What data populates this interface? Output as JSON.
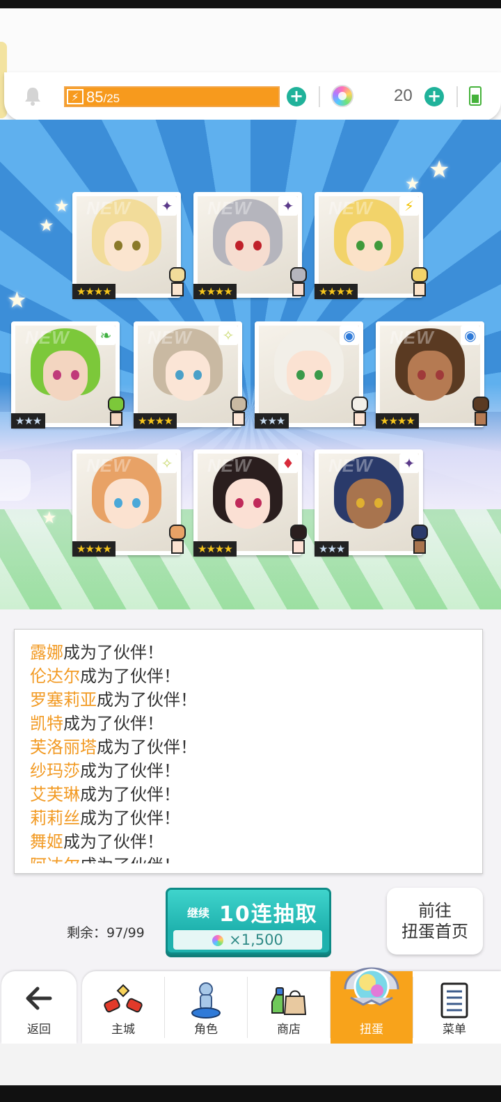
{
  "resources": {
    "stamina_current": "85",
    "stamina_max": "/25",
    "gem_count": "20"
  },
  "cards": [
    {
      "stars": "★★★★",
      "element": "✦",
      "element_color": "#5b3a8a",
      "hair": "#f2dc9a",
      "skin": "#fbe5cf",
      "eye": "#8a7a2a",
      "new": "NEW"
    },
    {
      "stars": "★★★★",
      "element": "✦",
      "element_color": "#5b3a8a",
      "hair": "#b5b5bd",
      "skin": "#f6ddd0",
      "eye": "#c0202a",
      "new": "NEW"
    },
    {
      "stars": "★★★★",
      "element": "⚡",
      "element_color": "#f2c200",
      "hair": "#f2d36a",
      "skin": "#fbe2c8",
      "eye": "#3f9a3a",
      "new": "NEW"
    },
    {
      "stars": "★★★",
      "element": "❧",
      "element_color": "#3fb040",
      "hair": "#7cc83a",
      "skin": "#f3d5c0",
      "eye": "#c03a7a",
      "new": "NEW"
    },
    {
      "stars": "★★★★",
      "element": "✧",
      "element_color": "#c8d86a",
      "hair": "#c9b9a2",
      "skin": "#fbe5d6",
      "eye": "#4aa0c8",
      "new": "NEW"
    },
    {
      "stars": "★★★",
      "element": "◉",
      "element_color": "#2f7ad8",
      "hair": "#f2efe8",
      "skin": "#fbe2d2",
      "eye": "#3a9a4a",
      "new": ""
    },
    {
      "stars": "★★★★",
      "element": "◉",
      "element_color": "#2f7ad8",
      "hair": "#5a3a22",
      "skin": "#b57a52",
      "eye": "#a03a3a",
      "new": "NEW"
    },
    {
      "stars": "★★★★",
      "element": "✧",
      "element_color": "#c8d86a",
      "hair": "#e8a266",
      "skin": "#fbe2d0",
      "eye": "#4aa8d8",
      "new": "NEW"
    },
    {
      "stars": "★★★★",
      "element": "♦",
      "element_color": "#d82a3a",
      "hair": "#2a1e1e",
      "skin": "#fbe0d4",
      "eye": "#c02a5a",
      "new": "NEW"
    },
    {
      "stars": "★★★",
      "element": "✦",
      "element_color": "#5b3a8a",
      "hair": "#2a3a6a",
      "skin": "#a8744e",
      "eye": "#e0b030",
      "new": "NEW"
    }
  ],
  "log": [
    {
      "name": "露娜",
      "suffix": "成为了伙伴！"
    },
    {
      "name": "伦达尔",
      "suffix": "成为了伙伴！"
    },
    {
      "name": "罗塞莉亚",
      "suffix": "成为了伙伴！"
    },
    {
      "name": "凯特",
      "suffix": "成为了伙伴！"
    },
    {
      "name": "芙洛丽塔",
      "suffix": "成为了伙伴！"
    },
    {
      "name": "纱玛莎",
      "suffix": "成为了伙伴！"
    },
    {
      "name": "艾芙琳",
      "suffix": "成为了伙伴！"
    },
    {
      "name": "莉莉丝",
      "suffix": "成为了伙伴！"
    },
    {
      "name": "舞姬",
      "suffix": "成为了伙伴！"
    },
    {
      "name": "阿达尔",
      "suffix": "成为了伙伴！"
    }
  ],
  "draw": {
    "remaining": "剩余：97/99",
    "continue": "继续",
    "label": "10连抽取",
    "cost": "×1,500"
  },
  "home_button": {
    "line1": "前往",
    "line2": "扭蛋首页"
  },
  "nav": {
    "back": "返回",
    "items": [
      "主城",
      "角色",
      "商店",
      "扭蛋",
      "菜单"
    ]
  }
}
